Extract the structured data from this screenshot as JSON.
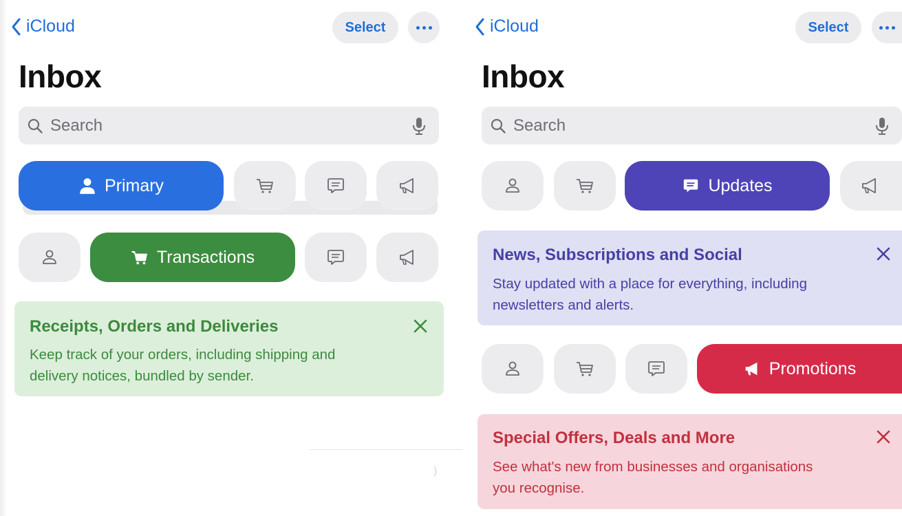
{
  "left": {
    "nav": {
      "back_label": "iCloud",
      "select_label": "Select",
      "more_icon": "ellipsis-icon"
    },
    "title": "Inbox",
    "search": {
      "placeholder": "Search",
      "icon": "magnifier-icon",
      "mic_icon": "microphone-icon"
    },
    "tab_row_1": [
      {
        "category": "primary",
        "label": "Primary",
        "active": true,
        "icon": "person-icon"
      },
      {
        "category": "transactions",
        "active": false,
        "icon": "cart-icon"
      },
      {
        "category": "updates",
        "active": false,
        "icon": "chat-bubble-icon"
      },
      {
        "category": "promotions",
        "active": false,
        "icon": "megaphone-icon"
      }
    ],
    "tab_row_2": [
      {
        "category": "primary",
        "active": false,
        "icon": "person-icon"
      },
      {
        "category": "transactions",
        "label": "Transactions",
        "active": true,
        "icon": "cart-icon"
      },
      {
        "category": "updates",
        "active": false,
        "icon": "chat-bubble-icon"
      },
      {
        "category": "promotions",
        "active": false,
        "icon": "megaphone-icon"
      }
    ],
    "banner": {
      "title": "Receipts, Orders and Deliveries",
      "description_line_1": "Keep track of your orders, including shipping and",
      "description_line_2": "delivery notices, bundled by sender.",
      "close_icon": "close-icon"
    }
  },
  "right": {
    "nav": {
      "back_label": "iCloud",
      "select_label": "Select",
      "more_icon": "ellipsis-icon"
    },
    "title": "Inbox",
    "search": {
      "placeholder": "Search",
      "icon": "magnifier-icon",
      "mic_icon": "microphone-icon"
    },
    "tab_row_1": [
      {
        "category": "primary",
        "active": false,
        "icon": "person-icon"
      },
      {
        "category": "transactions",
        "active": false,
        "icon": "cart-icon"
      },
      {
        "category": "updates",
        "label": "Updates",
        "active": true,
        "icon": "chat-bubble-icon"
      },
      {
        "category": "promotions",
        "active": false,
        "icon": "megaphone-icon"
      }
    ],
    "updates_banner": {
      "title": "News, Subscriptions and Social",
      "description_line_1": "Stay updated with a place for everything, including",
      "description_line_2": "newsletters and alerts.",
      "close_icon": "close-icon"
    },
    "tab_row_2": [
      {
        "category": "primary",
        "active": false,
        "icon": "person-icon"
      },
      {
        "category": "transactions",
        "active": false,
        "icon": "cart-icon"
      },
      {
        "category": "updates",
        "active": false,
        "icon": "chat-bubble-icon"
      },
      {
        "category": "promotions",
        "label": "Promotions",
        "active": true,
        "icon": "megaphone-icon"
      }
    ],
    "promotions_banner": {
      "title": "Special Offers, Deals and More",
      "description_line_1": "See what's new from businesses and organisations",
      "description_line_2": "you recognise.",
      "close_icon": "close-icon"
    }
  },
  "colors": {
    "accent_blue": "#1f6fd6",
    "primary_pill": "#2a6fe0",
    "transactions_pill": "#3c8d40",
    "updates_pill": "#4e44b8",
    "promotions_pill": "#d62b48",
    "transactions_banner_bg": "#dcefdb",
    "transactions_text": "#3c8a3d",
    "updates_banner_bg": "#dfe0f3",
    "updates_text": "#4740a6",
    "promotions_banner_bg": "#f6d6dc",
    "promotions_text": "#c2303f",
    "inactive_pill_bg": "#ececef",
    "inactive_icon": "#6b6b70"
  }
}
